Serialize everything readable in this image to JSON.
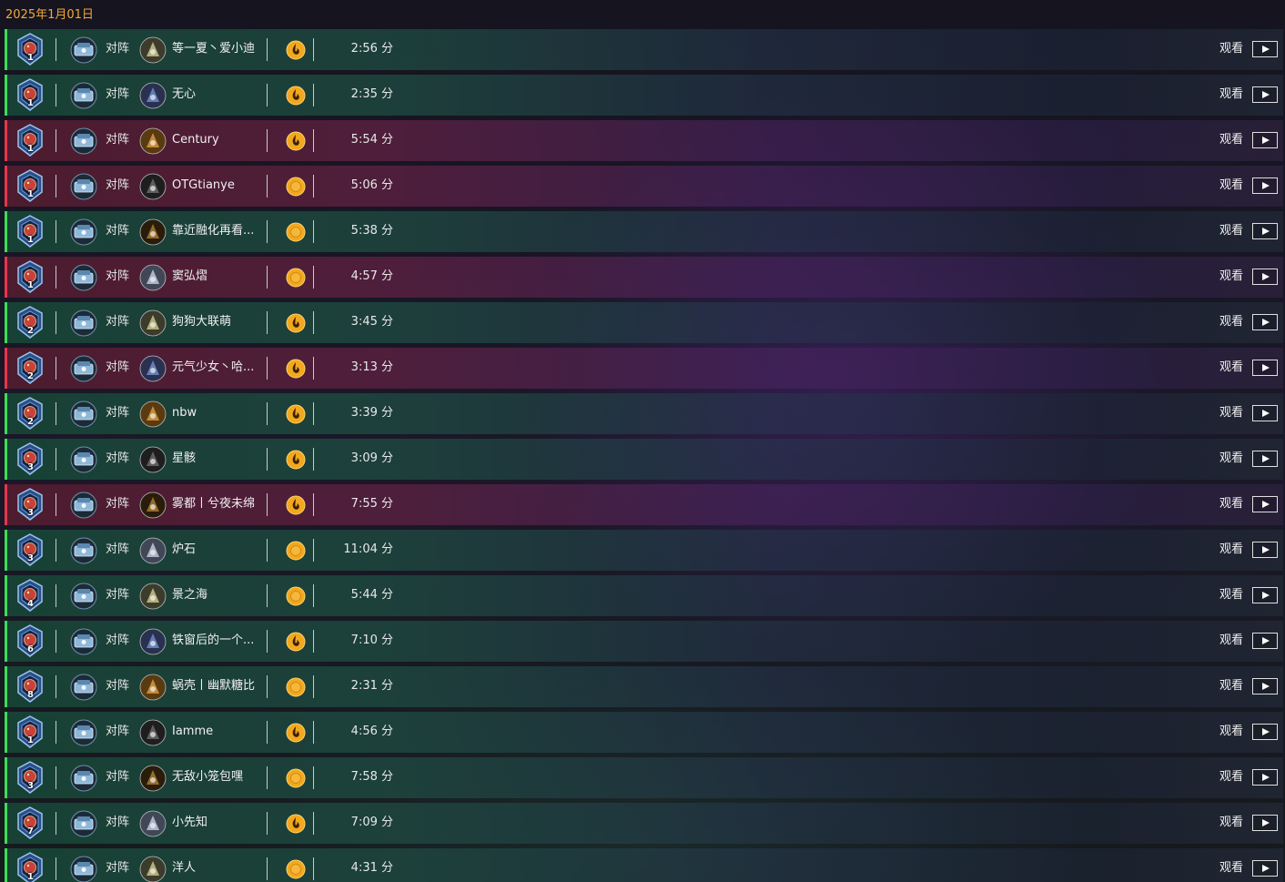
{
  "header": {
    "date": "2025年1月01日"
  },
  "mode_label": "对阵",
  "watch_label": "观看",
  "colors": {
    "win": "#3ddc54",
    "loss": "#e8354a",
    "accent": "#f3a83a"
  },
  "rows": [
    {
      "result": "win",
      "rank": "1",
      "opponent": "等一夏丶爱小迪",
      "coin": "flame",
      "duration": "2:56 分"
    },
    {
      "result": "win",
      "rank": "1",
      "opponent": "无心",
      "coin": "flame",
      "duration": "2:35 分"
    },
    {
      "result": "loss",
      "rank": "1",
      "opponent": "Century",
      "coin": "flame",
      "duration": "5:54 分"
    },
    {
      "result": "loss",
      "rank": "1",
      "opponent": "OTGtianye",
      "coin": "plain",
      "duration": "5:06 分"
    },
    {
      "result": "win",
      "rank": "1",
      "opponent": "靠近融化再看...",
      "coin": "plain",
      "duration": "5:38 分"
    },
    {
      "result": "loss",
      "rank": "1",
      "opponent": "窦弘熠",
      "coin": "plain",
      "duration": "4:57 分"
    },
    {
      "result": "win",
      "rank": "2",
      "opponent": "狗狗大联萌",
      "coin": "flame",
      "duration": "3:45 分"
    },
    {
      "result": "loss",
      "rank": "2",
      "opponent": "元气少女丶哈...",
      "coin": "flame",
      "duration": "3:13 分"
    },
    {
      "result": "win",
      "rank": "2",
      "opponent": "nbw",
      "coin": "flame",
      "duration": "3:39 分"
    },
    {
      "result": "win",
      "rank": "3",
      "opponent": "星骸",
      "coin": "flame",
      "duration": "3:09 分"
    },
    {
      "result": "loss",
      "rank": "3",
      "opponent": "雾都丨兮夜未绵",
      "coin": "flame",
      "duration": "7:55 分"
    },
    {
      "result": "win",
      "rank": "3",
      "opponent": "炉石",
      "coin": "plain",
      "duration": "11:04 分"
    },
    {
      "result": "win",
      "rank": "4",
      "opponent": "景之海",
      "coin": "plain",
      "duration": "5:44 分"
    },
    {
      "result": "win",
      "rank": "6",
      "opponent": "铁窗后的一个...",
      "coin": "flame",
      "duration": "7:10 分"
    },
    {
      "result": "win",
      "rank": "8",
      "opponent": "蜗壳丨幽默糖比",
      "coin": "plain",
      "duration": "2:31 分"
    },
    {
      "result": "win",
      "rank": "1",
      "opponent": "Iamme",
      "coin": "flame",
      "duration": "4:56 分"
    },
    {
      "result": "win",
      "rank": "3",
      "opponent": "无敌小笼包嘿",
      "coin": "plain",
      "duration": "7:58 分"
    },
    {
      "result": "win",
      "rank": "7",
      "opponent": "小先知",
      "coin": "flame",
      "duration": "7:09 分"
    },
    {
      "result": "win",
      "rank": "1",
      "opponent": "洋人",
      "coin": "plain",
      "duration": "4:31 分"
    }
  ],
  "row_icons": [
    {
      "rank_icon": "rank-medal-icon",
      "deck_icon": "deck-class-icon",
      "opponent_icon": "opponent-class-icon"
    }
  ]
}
